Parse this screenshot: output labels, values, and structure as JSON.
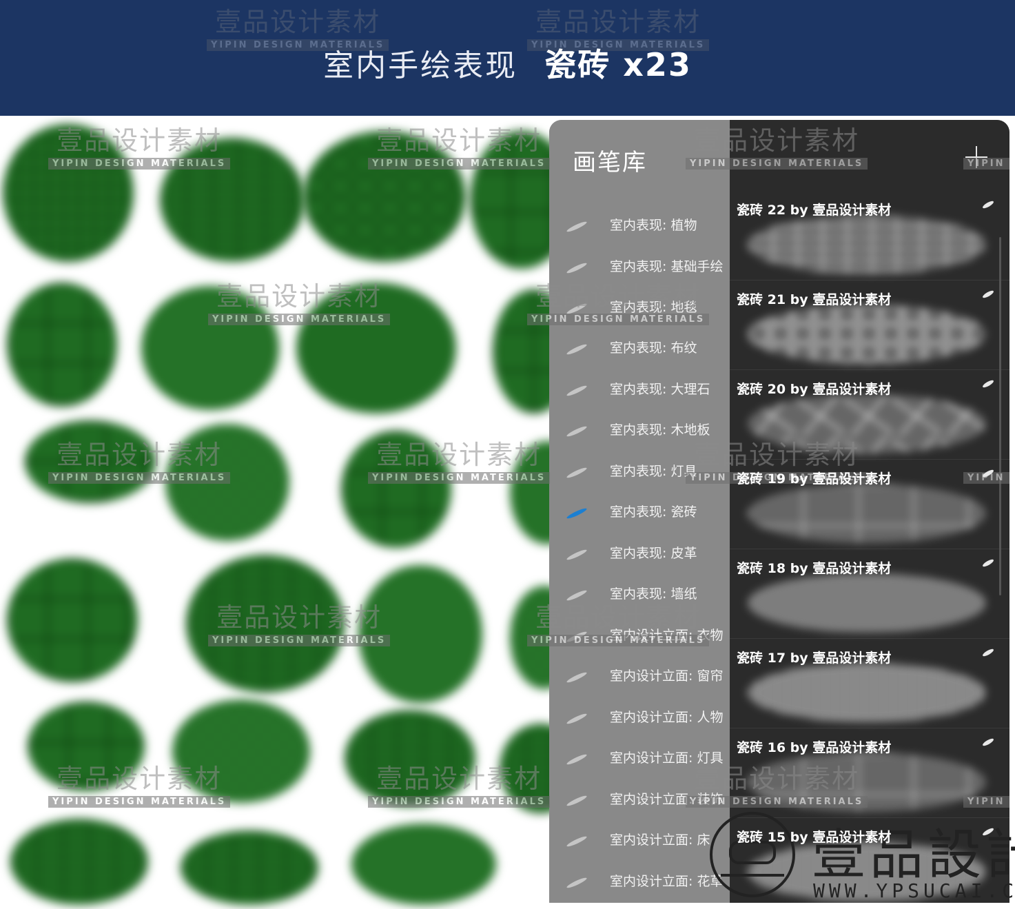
{
  "header": {
    "title_light": "室内手绘表现",
    "title_bold": "瓷砖 x23"
  },
  "watermark": {
    "zh": "壹品设计素材",
    "en": "YIPIN DESIGN MATERIALS",
    "en_short": "YIPIN"
  },
  "panel": {
    "title": "画笔库",
    "sidebar_items": [
      {
        "label": "室内表现: 植物"
      },
      {
        "label": "室内表现: 基础手绘"
      },
      {
        "label": "室内表现: 地毯"
      },
      {
        "label": "室内表现: 布纹"
      },
      {
        "label": "室内表现: 大理石"
      },
      {
        "label": "室内表现: 木地板"
      },
      {
        "label": "室内表现: 灯具"
      },
      {
        "label": "室内表现: 瓷砖"
      },
      {
        "label": "室内表现: 皮革"
      },
      {
        "label": "室内表现: 墙纸"
      },
      {
        "label": "室内设计立面: 衣物"
      },
      {
        "label": "室内设计立面: 窗帘"
      },
      {
        "label": "室内设计立面: 人物"
      },
      {
        "label": "室内设计立面: 灯具"
      },
      {
        "label": "室内设计立面: 装饰"
      },
      {
        "label": "室内设计立面: 床"
      },
      {
        "label": "室内设计立面: 花草"
      }
    ],
    "active_item": "室内表现: 瓷砖",
    "brushes": [
      {
        "name": "瓷砖 22 by 壹品设计素材"
      },
      {
        "name": "瓷砖 21 by 壹品设计素材"
      },
      {
        "name": "瓷砖 20 by 壹品设计素材"
      },
      {
        "name": "瓷砖 19 by 壹品设计素材"
      },
      {
        "name": "瓷砖 18 by 壹品设计素材"
      },
      {
        "name": "瓷砖 17 by 壹品设计素材"
      },
      {
        "name": "瓷砖 16 by 壹品设计素材"
      },
      {
        "name": "瓷砖 15 by 壹品设计素材"
      }
    ]
  },
  "logo": {
    "text": "壹品設計",
    "url": "WWW.YPSUCAI.COM"
  },
  "colors": {
    "banner": "#1c3563",
    "swatch_green": "#1f6b22",
    "sidebar": "#8a8a8a",
    "brush_list": "#2b2b2b",
    "active_stroke": "#1c7fd1"
  }
}
